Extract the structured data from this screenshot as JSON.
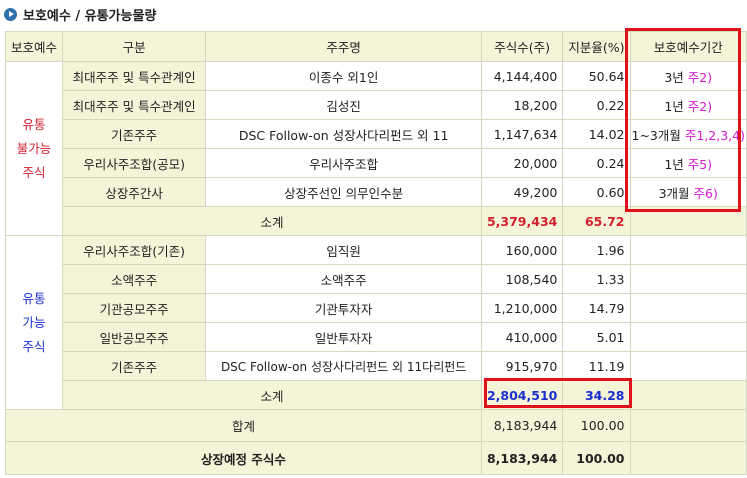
{
  "title": "보호예수 / 유통가능물량",
  "headers": [
    "보호예수",
    "구분",
    "주주명",
    "주식수(주)",
    "지분율(%)",
    "보호예수기간"
  ],
  "locked": {
    "group_label": [
      "유통",
      "불가능",
      "주식"
    ],
    "rows": [
      {
        "category": "최대주주 및 특수관계인",
        "holder": "이종수 외1인",
        "shares": "4,144,400",
        "ratio": "50.64",
        "period": "3년",
        "note": "주2)"
      },
      {
        "category": "최대주주 및 특수관계인",
        "holder": "김성진",
        "shares": "18,200",
        "ratio": "0.22",
        "period": "1년",
        "note": "주2)"
      },
      {
        "category": "기존주주",
        "holder": "DSC Follow-on 성장사다리펀드 외 11",
        "shares": "1,147,634",
        "ratio": "14.02",
        "period": "1~3개월",
        "note": "주1,2,3,4)"
      },
      {
        "category": "우리사주조합(공모)",
        "holder": "우리사주조합",
        "shares": "20,000",
        "ratio": "0.24",
        "period": "1년",
        "note": "주5)"
      },
      {
        "category": "상장주간사",
        "holder": "상장주선인 의무인수분",
        "shares": "49,200",
        "ratio": "0.60",
        "period": "3개월",
        "note": "주6)"
      }
    ],
    "subtotal": {
      "label": "소계",
      "shares": "5,379,434",
      "ratio": "65.72"
    }
  },
  "tradable": {
    "group_label": [
      "유통",
      "가능",
      "주식"
    ],
    "rows": [
      {
        "category": "우리사주조합(기존)",
        "holder": "임직원",
        "shares": "160,000",
        "ratio": "1.96"
      },
      {
        "category": "소액주주",
        "holder": "소액주주",
        "shares": "108,540",
        "ratio": "1.33"
      },
      {
        "category": "기관공모주주",
        "holder": "기관투자자",
        "shares": "1,210,000",
        "ratio": "14.79"
      },
      {
        "category": "일반공모주주",
        "holder": "일반투자자",
        "shares": "410,000",
        "ratio": "5.01"
      },
      {
        "category": "기존주주",
        "holder": "DSC Follow-on 성장사다리펀드 외 11다리펀드",
        "shares": "915,970",
        "ratio": "11.19"
      }
    ],
    "subtotal": {
      "label": "소계",
      "shares": "2,804,510",
      "ratio": "34.28"
    }
  },
  "total": {
    "label": "합계",
    "shares": "8,183,944",
    "ratio": "100.00"
  },
  "listing": {
    "label": "상장예정 주식수",
    "shares": "8,183,944",
    "ratio": "100.00"
  },
  "colors": {
    "header_bg": "#f4f4d8",
    "red": "#d3202e",
    "blue": "#1a2fd0",
    "note": "#d41ad1",
    "highlight_box": "#e0121a"
  }
}
